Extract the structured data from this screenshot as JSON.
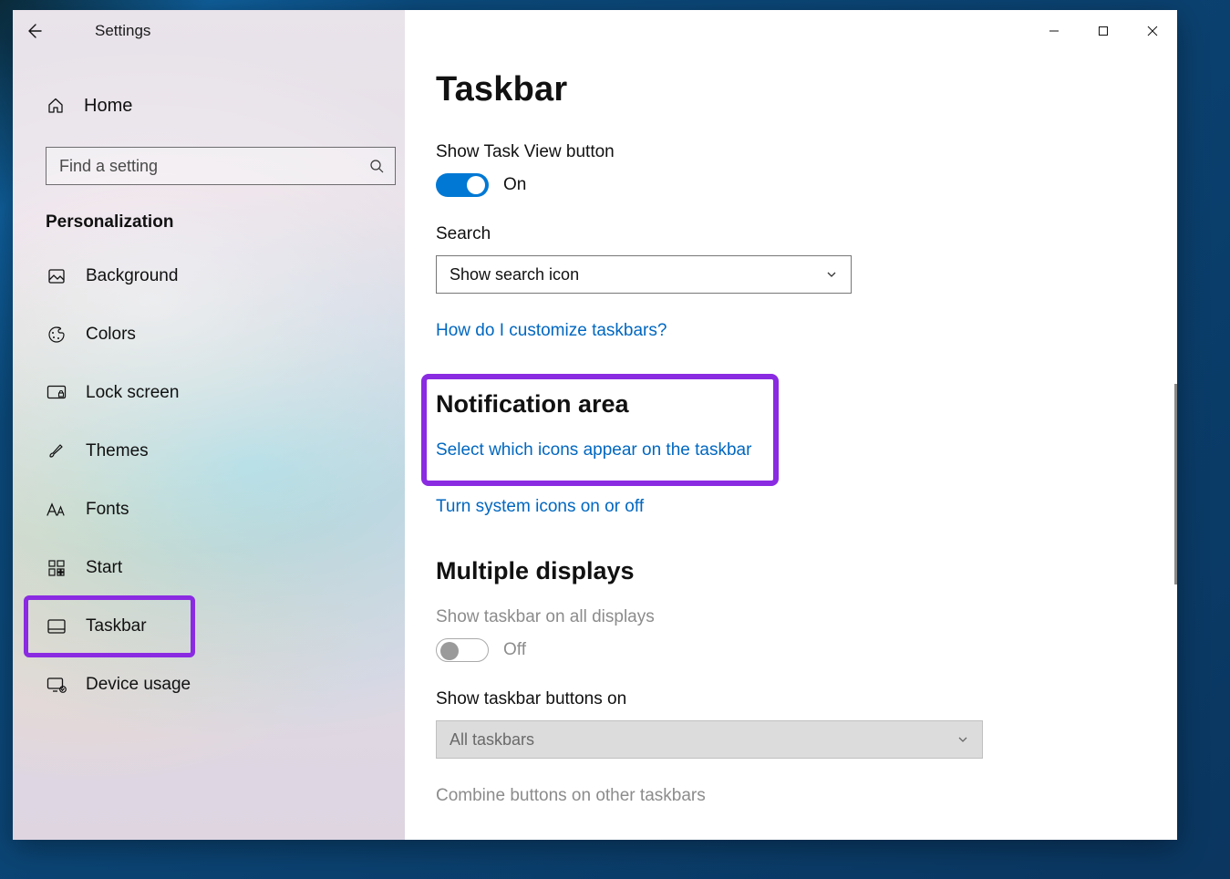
{
  "app": {
    "title": "Settings"
  },
  "sidebar": {
    "home": "Home",
    "search_placeholder": "Find a setting",
    "section": "Personalization",
    "items": [
      {
        "label": "Background"
      },
      {
        "label": "Colors"
      },
      {
        "label": "Lock screen"
      },
      {
        "label": "Themes"
      },
      {
        "label": "Fonts"
      },
      {
        "label": "Start"
      },
      {
        "label": "Taskbar"
      },
      {
        "label": "Device usage"
      }
    ]
  },
  "main": {
    "title": "Taskbar",
    "show_task_view": {
      "label": "Show Task View button",
      "state": "On"
    },
    "search": {
      "label": "Search",
      "value": "Show search icon"
    },
    "customize_link": "How do I customize taskbars?",
    "notification": {
      "title": "Notification area",
      "link_select_icons": "Select which icons appear on the taskbar",
      "link_system_icons": "Turn system icons on or off"
    },
    "multiple_displays": {
      "title": "Multiple displays",
      "show_on_all": {
        "label": "Show taskbar on all displays",
        "state": "Off"
      },
      "buttons_on": {
        "label": "Show taskbar buttons on",
        "value": "All taskbars"
      },
      "combine": "Combine buttons on other taskbars"
    }
  }
}
